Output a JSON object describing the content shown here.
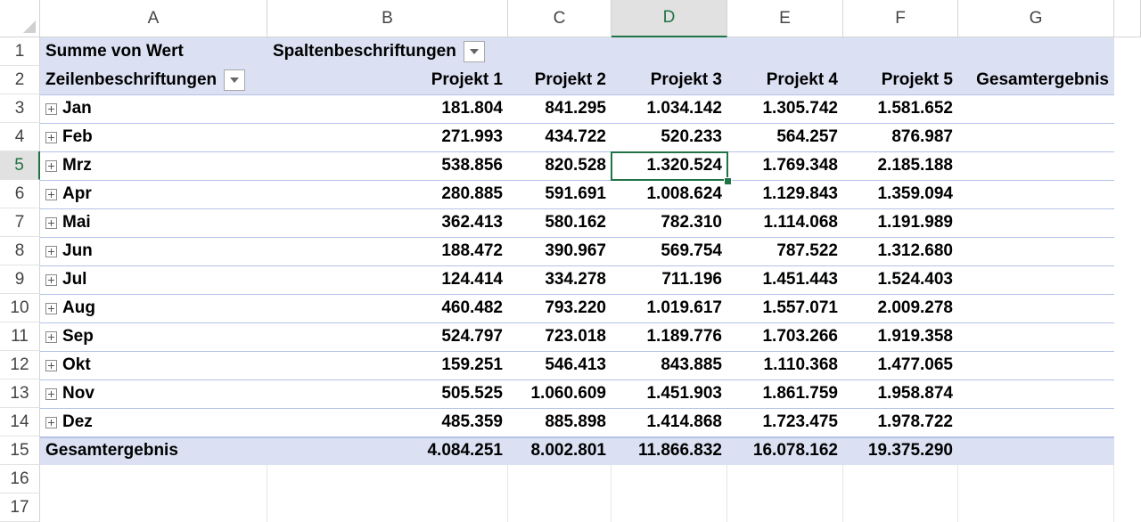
{
  "columns": [
    "A",
    "B",
    "C",
    "D",
    "E",
    "F",
    "G"
  ],
  "active_cell": {
    "column": "D",
    "row": "5"
  },
  "pivot": {
    "value_label": "Summe von Wert",
    "column_label": "Spaltenbeschriftungen",
    "row_label": "Zeilenbeschriftungen",
    "headers": [
      "Projekt 1",
      "Projekt 2",
      "Projekt 3",
      "Projekt 4",
      "Projekt 5",
      "Gesamtergebnis"
    ],
    "rows": [
      {
        "label": "Jan",
        "values": [
          "181.804",
          "841.295",
          "1.034.142",
          "1.305.742",
          "1.581.652",
          ""
        ]
      },
      {
        "label": "Feb",
        "values": [
          "271.993",
          "434.722",
          "520.233",
          "564.257",
          "876.987",
          ""
        ]
      },
      {
        "label": "Mrz",
        "values": [
          "538.856",
          "820.528",
          "1.320.524",
          "1.769.348",
          "2.185.188",
          ""
        ]
      },
      {
        "label": "Apr",
        "values": [
          "280.885",
          "591.691",
          "1.008.624",
          "1.129.843",
          "1.359.094",
          ""
        ]
      },
      {
        "label": "Mai",
        "values": [
          "362.413",
          "580.162",
          "782.310",
          "1.114.068",
          "1.191.989",
          ""
        ]
      },
      {
        "label": "Jun",
        "values": [
          "188.472",
          "390.967",
          "569.754",
          "787.522",
          "1.312.680",
          ""
        ]
      },
      {
        "label": "Jul",
        "values": [
          "124.414",
          "334.278",
          "711.196",
          "1.451.443",
          "1.524.403",
          ""
        ]
      },
      {
        "label": "Aug",
        "values": [
          "460.482",
          "793.220",
          "1.019.617",
          "1.557.071",
          "2.009.278",
          ""
        ]
      },
      {
        "label": "Sep",
        "values": [
          "524.797",
          "723.018",
          "1.189.776",
          "1.703.266",
          "1.919.358",
          ""
        ]
      },
      {
        "label": "Okt",
        "values": [
          "159.251",
          "546.413",
          "843.885",
          "1.110.368",
          "1.477.065",
          ""
        ]
      },
      {
        "label": "Nov",
        "values": [
          "505.525",
          "1.060.609",
          "1.451.903",
          "1.861.759",
          "1.958.874",
          ""
        ]
      },
      {
        "label": "Dez",
        "values": [
          "485.359",
          "885.898",
          "1.414.868",
          "1.723.475",
          "1.978.722",
          ""
        ]
      }
    ],
    "total": {
      "label": "Gesamtergebnis",
      "values": [
        "4.084.251",
        "8.002.801",
        "11.866.832",
        "16.078.162",
        "19.375.290",
        ""
      ]
    }
  },
  "row_numbers": [
    "1",
    "2",
    "3",
    "4",
    "5",
    "6",
    "7",
    "8",
    "9",
    "10",
    "11",
    "12",
    "13",
    "14",
    "15",
    "16",
    "17"
  ]
}
